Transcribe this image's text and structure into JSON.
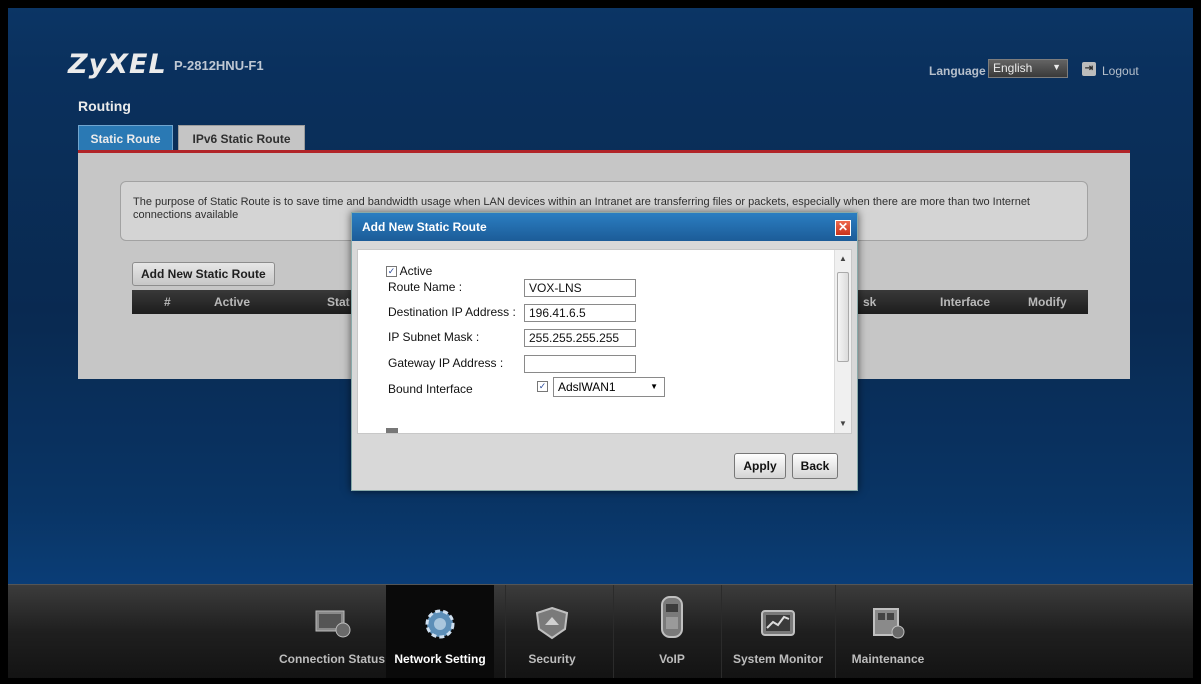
{
  "header": {
    "brand": "ZyXEL",
    "model": "P-2812HNU-F1",
    "language_label": "Language :",
    "language_value": "English",
    "logout_label": "Logout"
  },
  "page": {
    "title": "Routing",
    "tabs": [
      {
        "label": "Static Route",
        "active": true
      },
      {
        "label": "IPv6 Static Route",
        "active": false
      }
    ],
    "info_text": "The purpose of Static Route is to save time and bandwidth usage when LAN devices within an Intranet are transferring files or packets, especially when there are more than two Internet connections available",
    "add_button": "Add New Static Route",
    "table_columns": [
      "#",
      "Active",
      "Stat",
      "sk",
      "Interface",
      "Modify"
    ]
  },
  "modal": {
    "title": "Add New Static Route",
    "active_label": "Active",
    "active_checked": true,
    "fields": {
      "route_name_label": "Route Name :",
      "route_name_value": "VOX-LNS",
      "dest_ip_label": "Destination IP Address :",
      "dest_ip_value": "196.41.6.5",
      "subnet_label": "IP Subnet Mask :",
      "subnet_value": "255.255.255.255",
      "gateway_label": "Gateway IP Address :",
      "gateway_value": "",
      "bound_label": "Bound Interface",
      "bound_checked": true,
      "bound_value": "AdslWAN1"
    },
    "apply_label": "Apply",
    "back_label": "Back"
  },
  "bottom_nav": [
    {
      "label": "Connection Status",
      "icon": "connection-status-icon",
      "active": false
    },
    {
      "label": "Network Setting",
      "icon": "network-setting-icon",
      "active": true
    },
    {
      "label": "Security",
      "icon": "security-icon",
      "active": false
    },
    {
      "label": "VoIP",
      "icon": "voip-icon",
      "active": false
    },
    {
      "label": "System Monitor",
      "icon": "system-monitor-icon",
      "active": false
    },
    {
      "label": "Maintenance",
      "icon": "maintenance-icon",
      "active": false
    }
  ],
  "colors": {
    "accent_blue": "#2e84c4",
    "tab_red_line": "#c0282c",
    "background": "#0a2d58"
  }
}
